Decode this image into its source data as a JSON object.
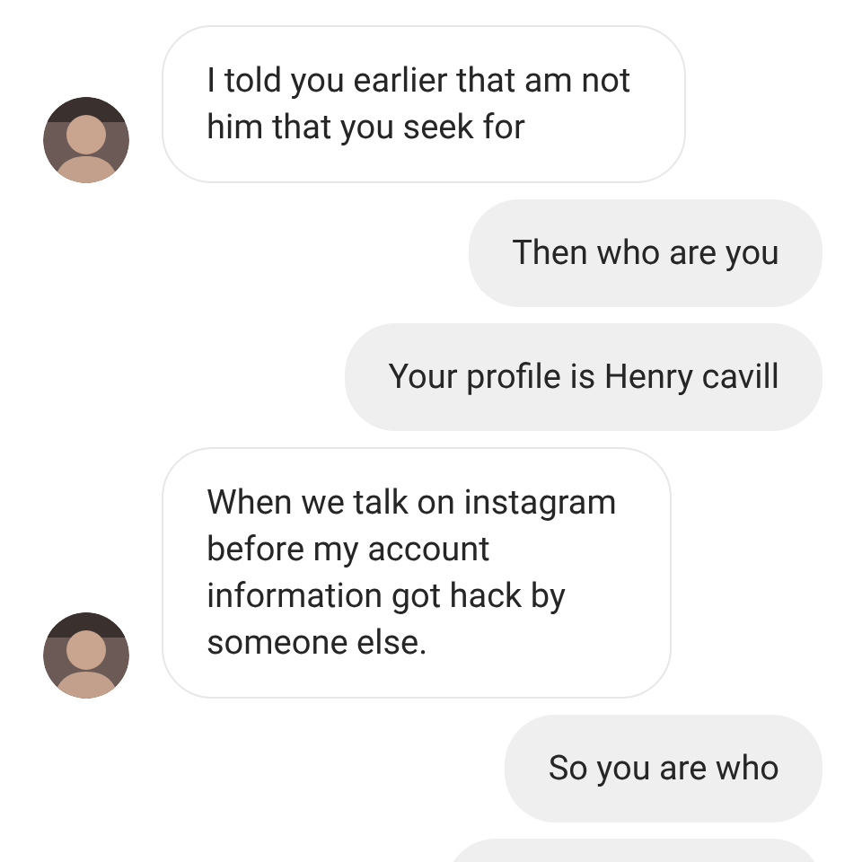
{
  "messages": [
    {
      "outgoing": false,
      "lines": [
        "I told you earlier that am not",
        "him that you seek for"
      ]
    },
    {
      "outgoing": true,
      "lines": [
        "Then who are you"
      ]
    },
    {
      "outgoing": true,
      "lines": [
        "Your profile is Henry cavill"
      ]
    },
    {
      "outgoing": false,
      "lines": [
        "When we talk on instagram",
        "before my account",
        "information got hack by",
        "someone else."
      ]
    },
    {
      "outgoing": true,
      "lines": [
        "So you are who"
      ]
    },
    {
      "outgoing": true
    }
  ]
}
